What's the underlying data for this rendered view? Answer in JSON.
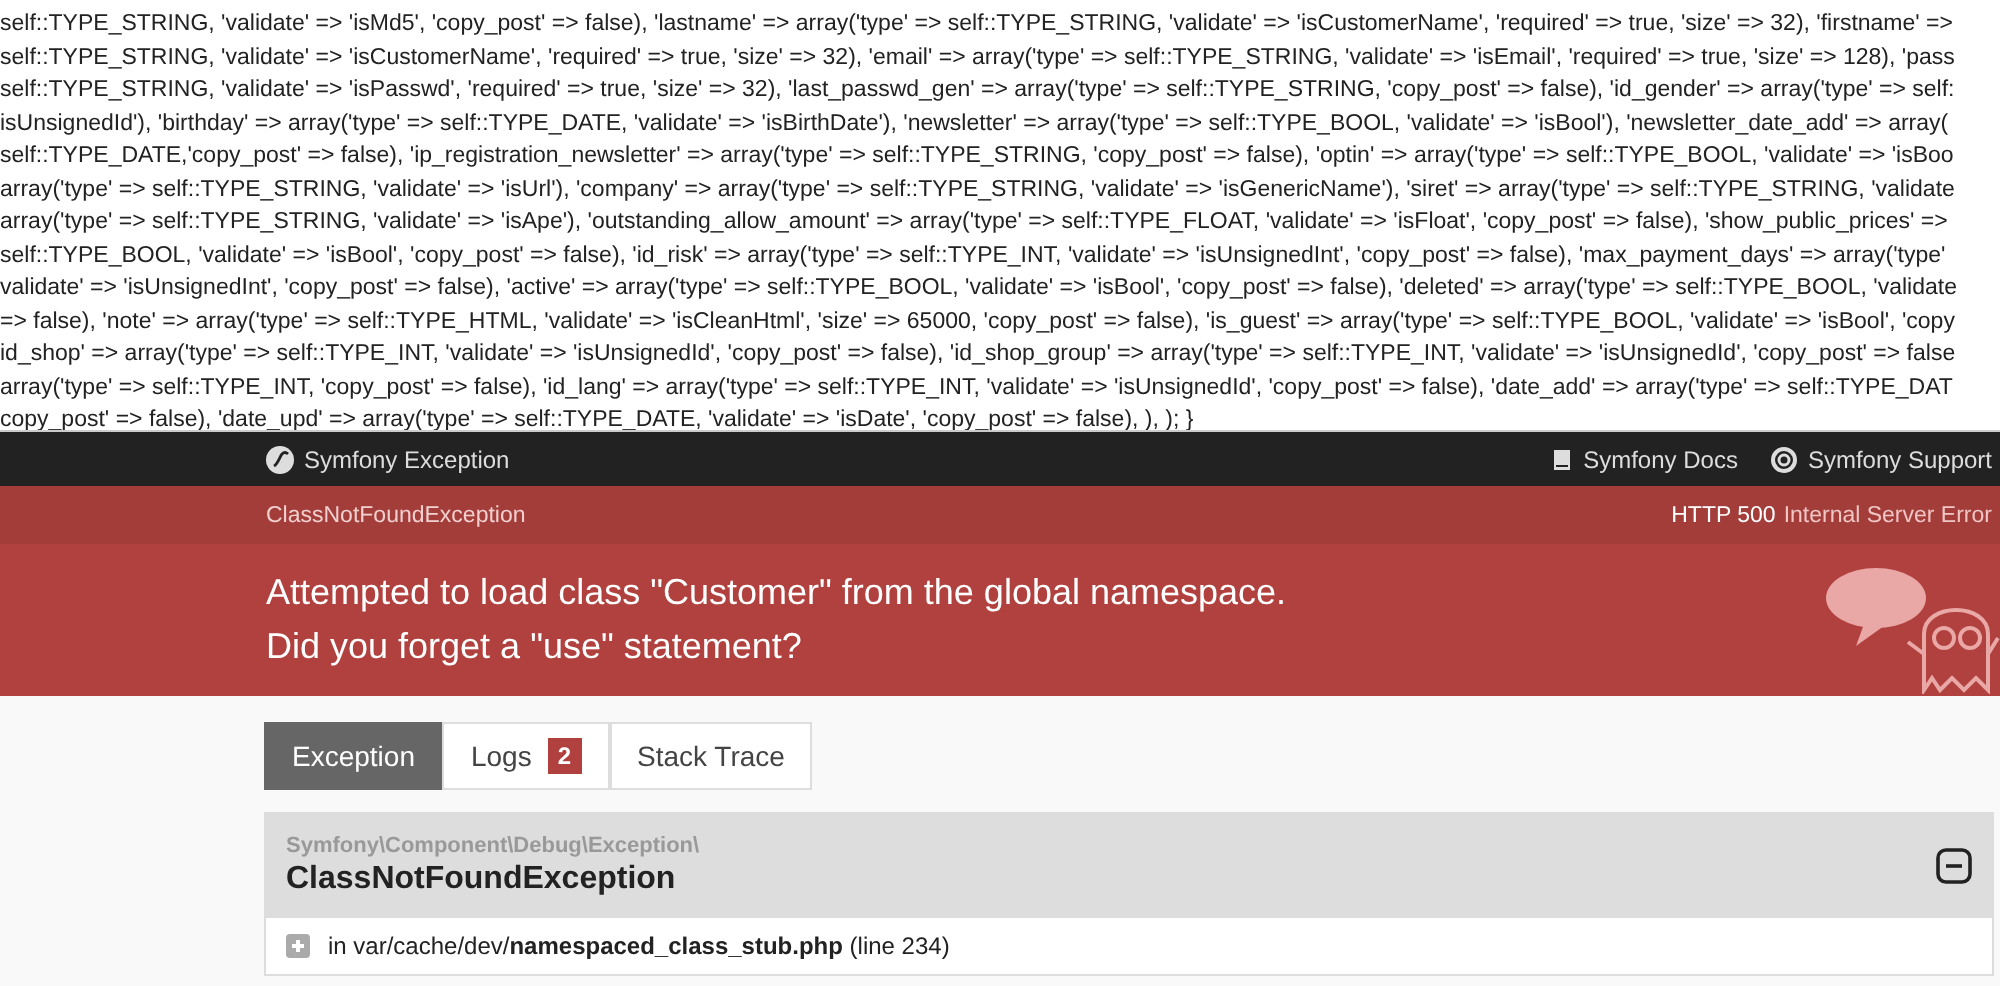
{
  "source_code": {
    "lines": [
      "self::TYPE_STRING, 'validate' => 'isMd5', 'copy_post' => false), 'lastname' => array('type' => self::TYPE_STRING, 'validate' => 'isCustomerName', 'required' => true, 'size' => 32), 'firstname' =>",
      "self::TYPE_STRING, 'validate' => 'isCustomerName', 'required' => true, 'size' => 32), 'email' => array('type' => self::TYPE_STRING, 'validate' => 'isEmail', 'required' => true, 'size' => 128), 'pass",
      "self::TYPE_STRING, 'validate' => 'isPasswd', 'required' => true, 'size' => 32), 'last_passwd_gen' => array('type' => self::TYPE_STRING, 'copy_post' => false), 'id_gender' => array('type' => self:",
      "isUnsignedId'), 'birthday' => array('type' => self::TYPE_DATE, 'validate' => 'isBirthDate'), 'newsletter' => array('type' => self::TYPE_BOOL, 'validate' => 'isBool'), 'newsletter_date_add' => array(",
      "self::TYPE_DATE,'copy_post' => false), 'ip_registration_newsletter' => array('type' => self::TYPE_STRING, 'copy_post' => false), 'optin' => array('type' => self::TYPE_BOOL, 'validate' => 'isBoo",
      "array('type' => self::TYPE_STRING, 'validate' => 'isUrl'), 'company' => array('type' => self::TYPE_STRING, 'validate' => 'isGenericName'), 'siret' => array('type' => self::TYPE_STRING, 'validate",
      "array('type' => self::TYPE_STRING, 'validate' => 'isApe'), 'outstanding_allow_amount' => array('type' => self::TYPE_FLOAT, 'validate' => 'isFloat', 'copy_post' => false), 'show_public_prices' =>",
      "self::TYPE_BOOL, 'validate' => 'isBool', 'copy_post' => false), 'id_risk' => array('type' => self::TYPE_INT, 'validate' => 'isUnsignedInt', 'copy_post' => false), 'max_payment_days' => array('type'",
      "validate' => 'isUnsignedInt', 'copy_post' => false), 'active' => array('type' => self::TYPE_BOOL, 'validate' => 'isBool', 'copy_post' => false), 'deleted' => array('type' => self::TYPE_BOOL, 'validate",
      "=> false), 'note' => array('type' => self::TYPE_HTML, 'validate' => 'isCleanHtml', 'size' => 65000, 'copy_post' => false), 'is_guest' => array('type' => self::TYPE_BOOL, 'validate' => 'isBool', 'copy",
      "id_shop' => array('type' => self::TYPE_INT, 'validate' => 'isUnsignedId', 'copy_post' => false), 'id_shop_group' => array('type' => self::TYPE_INT, 'validate' => 'isUnsignedId', 'copy_post' => false",
      "array('type' => self::TYPE_INT, 'copy_post' => false), 'id_lang' => array('type' => self::TYPE_INT, 'validate' => 'isUnsignedId', 'copy_post' => false), 'date_add' => array('type' => self::TYPE_DAT",
      "copy_post' => false), 'date_upd' => array('type' => self::TYPE_DATE, 'validate' => 'isDate', 'copy_post' => false), ), ); }"
    ]
  },
  "header": {
    "brand": "Symfony Exception",
    "links": [
      {
        "kind": "docs",
        "label": "Symfony Docs"
      },
      {
        "kind": "support",
        "label": "Symfony Support"
      }
    ]
  },
  "summary": {
    "exception_class": "ClassNotFoundException",
    "status_code": "HTTP 500",
    "status_text": "Internal Server Error",
    "message_lines": [
      "Attempted to load class \"Customer\" from the global namespace.",
      "Did you forget a \"use\" statement?"
    ]
  },
  "tabs": [
    {
      "label": "Exception",
      "selected": true
    },
    {
      "label": "Logs",
      "badge": "2",
      "selected": false
    },
    {
      "label": "Stack Trace",
      "selected": false
    }
  ],
  "exception": {
    "namespace": "Symfony\\Component\\Debug\\Exception\\",
    "class": "ClassNotFoundException",
    "expanded": true,
    "trace": [
      {
        "text": "in var/cache/dev/**namespaced_class_stub.php** (line 234)",
        "expanded": false
      }
    ]
  }
}
